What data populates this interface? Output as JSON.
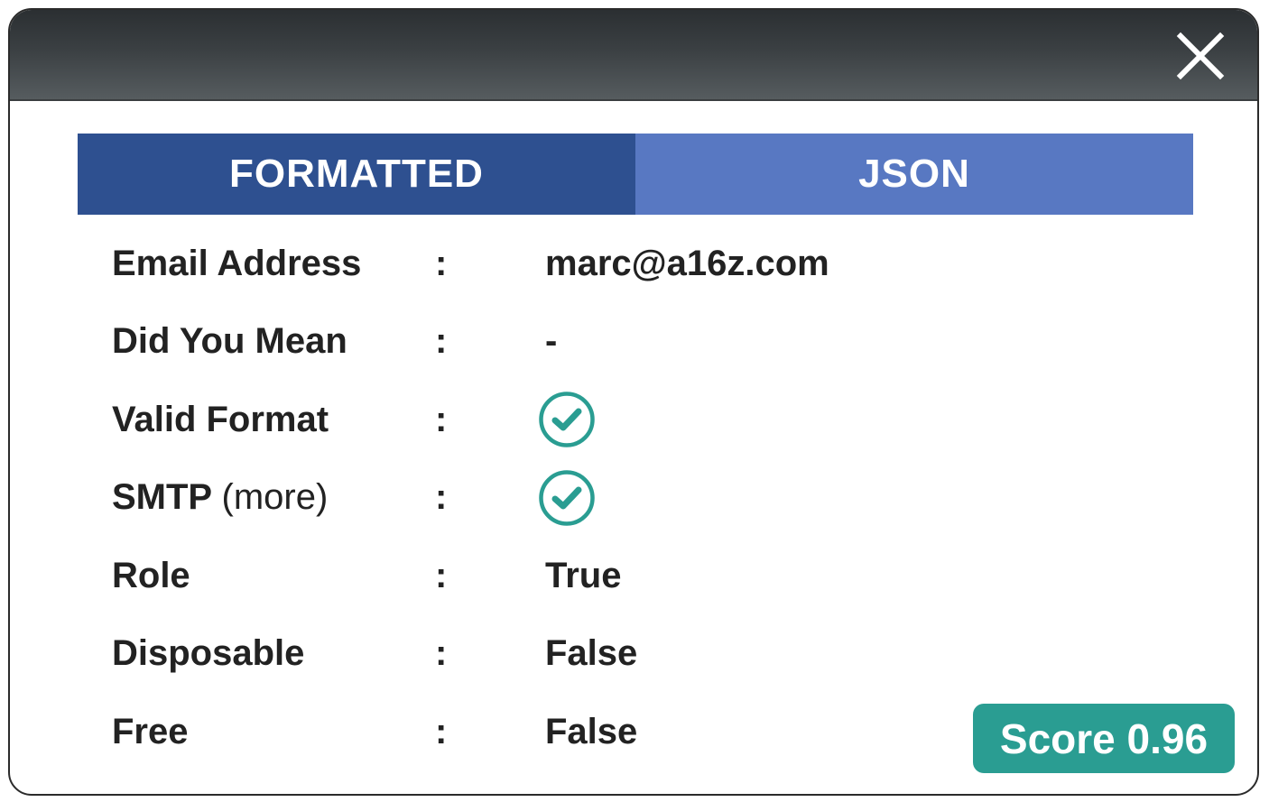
{
  "tabs": {
    "formatted": "FORMATTED",
    "json": "JSON"
  },
  "rows": [
    {
      "label": "Email Address",
      "colon": ":",
      "value": "marc@a16z.com"
    },
    {
      "label": "Did You Mean",
      "colon": ":",
      "value": "-"
    },
    {
      "label": "Valid Format",
      "colon": ":",
      "value_icon": "check-circle-icon"
    },
    {
      "label": "SMTP",
      "label_link": "(more)",
      "colon": ":",
      "value_icon": "check-circle-icon"
    },
    {
      "label": "Role",
      "colon": ":",
      "value": "True"
    },
    {
      "label": "Disposable",
      "colon": ":",
      "value": "False"
    },
    {
      "label": "Free",
      "colon": ":",
      "value": "False"
    }
  ],
  "score": {
    "label": "Score 0.96"
  },
  "colors": {
    "tab_active": "#2e5090",
    "tab_inactive": "#5878c2",
    "accent": "#2a9d92",
    "text": "#222222"
  },
  "icons": {
    "close": "close-icon",
    "check": "check-circle-icon"
  }
}
